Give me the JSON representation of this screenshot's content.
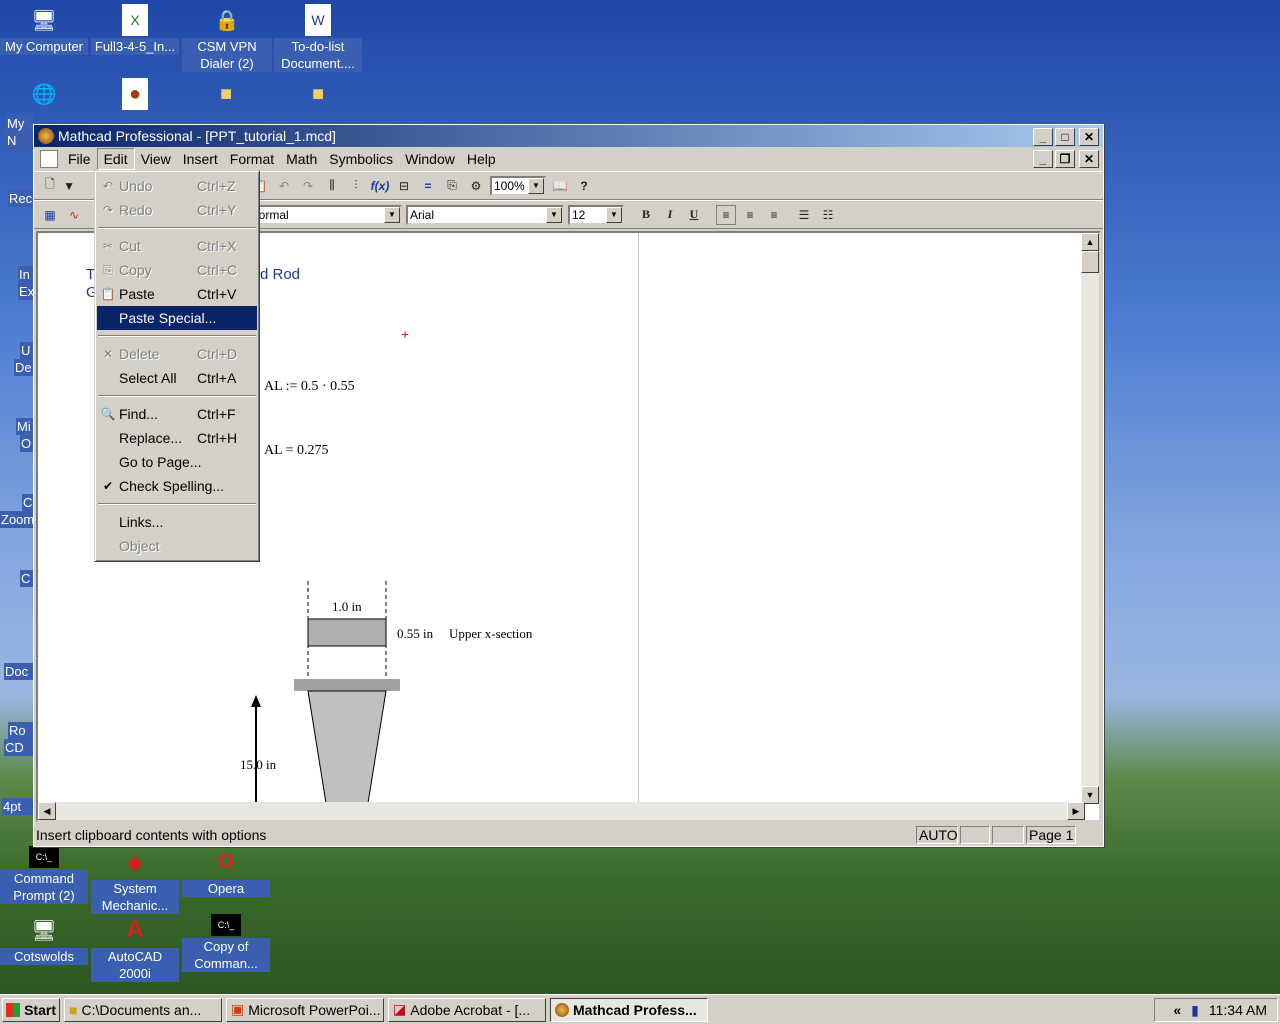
{
  "desktop": {
    "icons": [
      {
        "label": "My Computer",
        "icon": "computer-icon"
      },
      {
        "label": "Full3-4-5_In...",
        "icon": "excel-file-icon"
      },
      {
        "label": "CSM VPN Dialer (2)",
        "icon": "vpn-shortcut-icon"
      },
      {
        "label": "To-do-list Document....",
        "icon": "word-file-icon"
      },
      {
        "label": "Command Prompt (2)",
        "icon": "command-prompt-icon"
      },
      {
        "label": "System Mechanic...",
        "icon": "system-mechanic-icon"
      },
      {
        "label": "Opera",
        "icon": "opera-icon"
      },
      {
        "label": "Cotswolds",
        "icon": "network-shortcut-icon"
      },
      {
        "label": "AutoCAD 2000i",
        "icon": "autocad-icon"
      },
      {
        "label": "Copy of Comman...",
        "icon": "command-prompt-icon"
      }
    ],
    "partial_labels": [
      "My N",
      "Rec",
      "In",
      "Ex",
      "U",
      "De",
      "Mi",
      "O",
      "C",
      "Zoom",
      "C",
      "Doc",
      "Ro",
      "CD",
      "4pt"
    ]
  },
  "window": {
    "app": "Mathcad Professional",
    "doc": "- [PPT_tutorial_1.mcd]"
  },
  "menubar": [
    "File",
    "Edit",
    "View",
    "Insert",
    "Format",
    "Math",
    "Symbolics",
    "Window",
    "Help"
  ],
  "toolbar": {
    "zoom": "100%",
    "style": "Normal",
    "font": "Arial",
    "size": "12",
    "bold": "B",
    "italic": "I",
    "underline": "U"
  },
  "edit_menu": [
    {
      "icon": "undo-icon",
      "label": "Undo",
      "shortcut": "Ctrl+Z",
      "disabled": true
    },
    {
      "icon": "redo-icon",
      "label": "Redo",
      "shortcut": "Ctrl+Y",
      "disabled": true
    },
    {
      "sep": true
    },
    {
      "icon": "cut-icon",
      "label": "Cut",
      "shortcut": "Ctrl+X",
      "disabled": true
    },
    {
      "icon": "copy-icon",
      "label": "Copy",
      "shortcut": "Ctrl+C",
      "disabled": true
    },
    {
      "icon": "paste-icon",
      "label": "Paste",
      "shortcut": "Ctrl+V",
      "disabled": false
    },
    {
      "icon": "",
      "label": "Paste Special...",
      "shortcut": "",
      "disabled": false,
      "highlight": true
    },
    {
      "sep": true
    },
    {
      "icon": "delete-icon",
      "label": "Delete",
      "shortcut": "Ctrl+D",
      "disabled": true
    },
    {
      "icon": "",
      "label": "Select All",
      "shortcut": "Ctrl+A",
      "disabled": false
    },
    {
      "sep": true
    },
    {
      "icon": "find-icon",
      "label": "Find...",
      "shortcut": "Ctrl+F",
      "disabled": false
    },
    {
      "icon": "",
      "label": "Replace...",
      "shortcut": "Ctrl+H",
      "disabled": false
    },
    {
      "icon": "",
      "label": "Go to Page...",
      "shortcut": "",
      "disabled": false
    },
    {
      "icon": "spelling-icon",
      "label": "Check Spelling...",
      "shortcut": "",
      "disabled": false
    },
    {
      "sep": true
    },
    {
      "icon": "",
      "label": "Links...",
      "shortcut": "",
      "disabled": false
    },
    {
      "icon": "",
      "label": "Object",
      "shortcut": "",
      "disabled": true
    }
  ],
  "document": {
    "heading_t": "T",
    "heading_rest": "d Rod",
    "heading_g": "G",
    "eq1": "AL := 0.5 · 0.55",
    "eq2": "AL = 0.275",
    "dim_width": "1.0 in",
    "dim_thick": "0.55 in",
    "section_label": "Upper x-section",
    "dim_length": "15.0 in"
  },
  "status": {
    "text": "Insert clipboard contents with options",
    "mode": "AUTO",
    "page": "Page 1"
  },
  "taskbar": {
    "start": "Start",
    "items": [
      {
        "label": "C:\\Documents an...",
        "icon": "folder-icon"
      },
      {
        "label": "Microsoft PowerPoi...",
        "icon": "powerpoint-icon"
      },
      {
        "label": "Adobe Acrobat - [...",
        "icon": "acrobat-icon"
      },
      {
        "label": "Mathcad Profess...",
        "icon": "mathcad-icon",
        "active": true
      }
    ],
    "clock": "11:34 AM",
    "tray_arrow": "«"
  }
}
